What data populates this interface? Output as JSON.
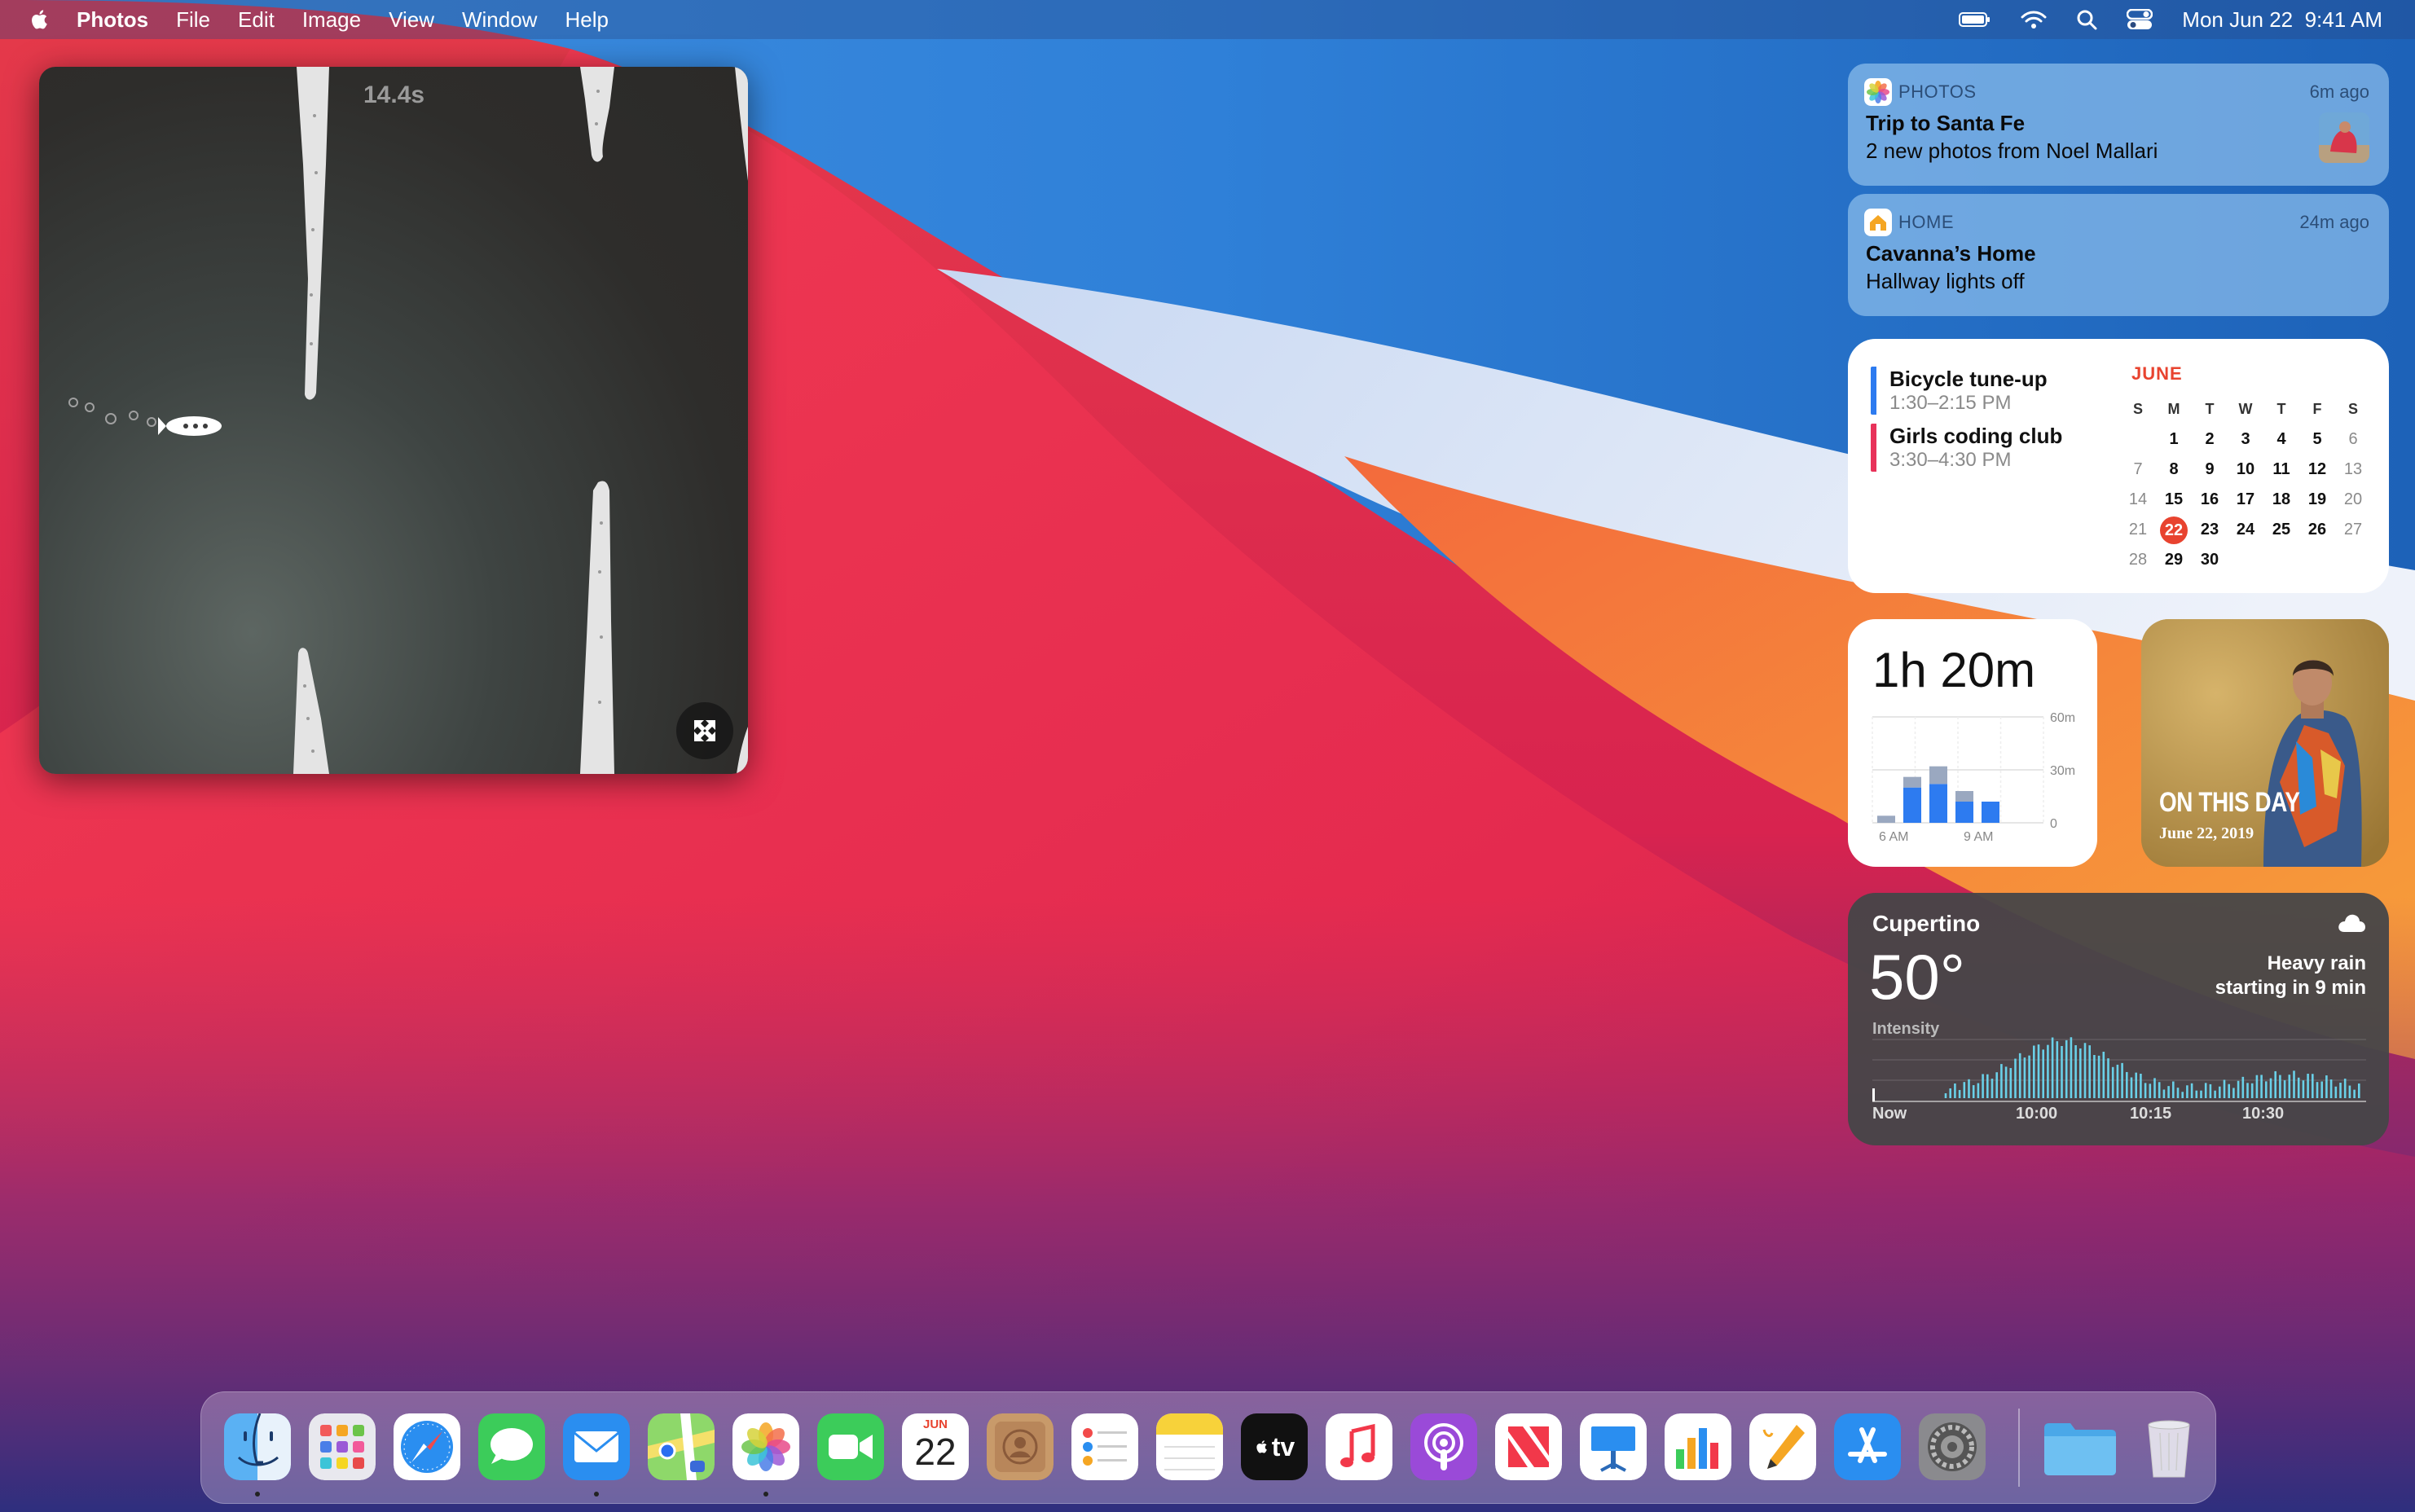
{
  "menubar": {
    "app_name": "Photos",
    "menus": [
      "File",
      "Edit",
      "Image",
      "View",
      "Window",
      "Help"
    ],
    "clock": "Mon Jun 22  9:41 AM",
    "status_icons": [
      "battery-icon",
      "wifi-icon",
      "search-icon",
      "control-center-icon"
    ]
  },
  "pip": {
    "timer": "14.4s",
    "button_icon": "expand-icon"
  },
  "notifications": [
    {
      "app": "PHOTOS",
      "time": "6m ago",
      "title": "Trip to Santa Fe",
      "body": "2 new photos from Noel Mallari"
    },
    {
      "app": "HOME",
      "time": "24m ago",
      "title": "Cavanna’s Home",
      "body": "Hallway lights off"
    }
  ],
  "calendar": {
    "events": [
      {
        "title": "Bicycle tune-up",
        "time": "1:30–2:15 PM",
        "color": "#2d7bf0"
      },
      {
        "title": "Girls coding club",
        "time": "3:30–4:30 PM",
        "color": "#e8325a"
      }
    ],
    "month": "JUNE",
    "dow": [
      "S",
      "M",
      "T",
      "W",
      "T",
      "F",
      "S"
    ],
    "weeks": [
      [
        "",
        "1",
        "2",
        "3",
        "4",
        "5",
        "6"
      ],
      [
        "7",
        "8",
        "9",
        "10",
        "11",
        "12",
        "13"
      ],
      [
        "14",
        "15",
        "16",
        "17",
        "18",
        "19",
        "20"
      ],
      [
        "21",
        "22",
        "23",
        "24",
        "25",
        "26",
        "27"
      ],
      [
        "28",
        "29",
        "30",
        "",
        "",
        "",
        ""
      ]
    ],
    "today": "22"
  },
  "screentime": {
    "total": "1h 20m",
    "y_labels": [
      "60m",
      "30m",
      "0"
    ],
    "x_labels": [
      "6 AM",
      "9 AM"
    ],
    "bars": [
      {
        "blue": 0,
        "gray": 4
      },
      {
        "blue": 20,
        "gray": 6
      },
      {
        "blue": 22,
        "gray": 10
      },
      {
        "blue": 12,
        "gray": 6
      },
      {
        "blue": 12,
        "gray": 0
      }
    ]
  },
  "photo_widget": {
    "title": "ON THIS DAY",
    "date": "June 22, 2019"
  },
  "weather": {
    "city": "Cupertino",
    "temperature": "50°",
    "condition_line1": "Heavy rain",
    "condition_line2": "starting in 9 min",
    "intensity_label": "Intensity",
    "timeline": [
      "Now",
      "10:00",
      "10:15",
      "10:30"
    ],
    "icon": "cloud-icon"
  },
  "dock": {
    "apps": [
      {
        "name": "finder",
        "running": true
      },
      {
        "name": "launchpad",
        "running": false
      },
      {
        "name": "safari",
        "running": false
      },
      {
        "name": "messages",
        "running": false
      },
      {
        "name": "mail",
        "running": true
      },
      {
        "name": "maps",
        "running": false
      },
      {
        "name": "photos",
        "running": true
      },
      {
        "name": "facetime",
        "running": false
      },
      {
        "name": "calendar",
        "running": false,
        "month": "JUN",
        "day": "22"
      },
      {
        "name": "contacts",
        "running": false
      },
      {
        "name": "reminders",
        "running": false
      },
      {
        "name": "notes",
        "running": false
      },
      {
        "name": "apple-tv",
        "running": false,
        "label": "tv"
      },
      {
        "name": "music",
        "running": false
      },
      {
        "name": "podcasts",
        "running": false
      },
      {
        "name": "news",
        "running": false
      },
      {
        "name": "keynote",
        "running": false
      },
      {
        "name": "numbers",
        "running": false
      },
      {
        "name": "pages",
        "running": false
      },
      {
        "name": "app-store",
        "running": false
      },
      {
        "name": "system-preferences",
        "running": false
      },
      {
        "name": "downloads-folder",
        "running": false
      },
      {
        "name": "trash",
        "running": false
      }
    ]
  }
}
